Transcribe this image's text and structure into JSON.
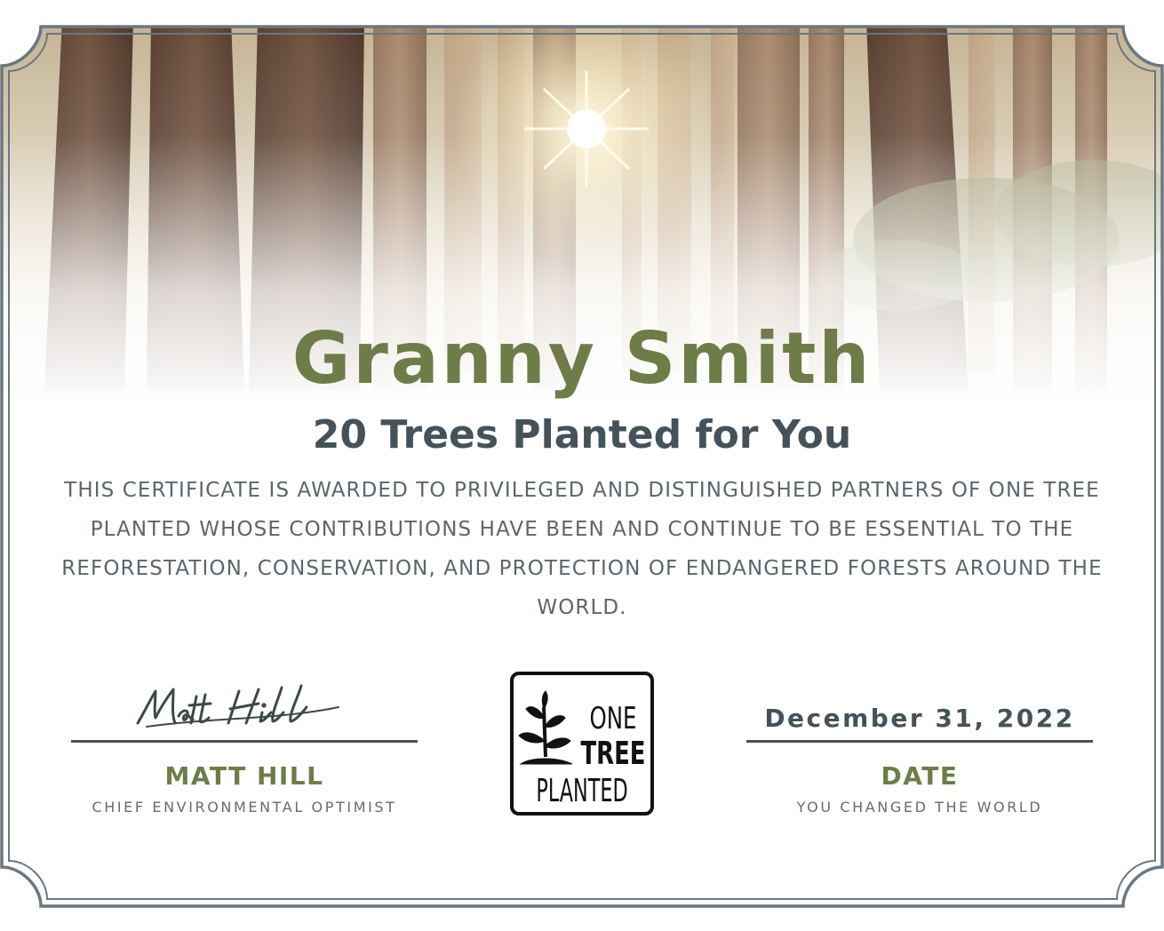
{
  "certificate": {
    "recipient_name": "Granny Smith",
    "subtitle": "20 Trees Planted for You",
    "description": "THIS CERTIFICATE IS AWARDED TO PRIVILEGED AND DISTINGUISHED PARTNERS OF ONE TREE PLANTED WHOSE CONTRIBUTIONS HAVE BEEN AND CONTINUE TO BE ESSENTIAL TO THE REFORESTATION, CONSERVATION, AND PROTECTION OF ENDANGERED FORESTS AROUND THE WORLD."
  },
  "signature": {
    "signature_script": "Matt Hill",
    "name": "MATT HILL",
    "title": "CHIEF ENVIRONMENTAL OPTIMIST"
  },
  "date": {
    "value": "December 31, 2022",
    "label": "DATE",
    "caption": "YOU CHANGED THE WORLD"
  },
  "logo": {
    "line1": "ONE",
    "line2": "TREE",
    "line3": "PLANTED",
    "icon": "sapling-icon"
  },
  "decoration": {
    "background": "sunlit-redwood-forest",
    "frame": "scalloped-corner-double-border"
  },
  "colors": {
    "name_green": "#6e7d47",
    "slate": "#44525b",
    "body_text": "#5b666c",
    "caption_text": "#6a6a6a",
    "border": "#6b7780"
  }
}
